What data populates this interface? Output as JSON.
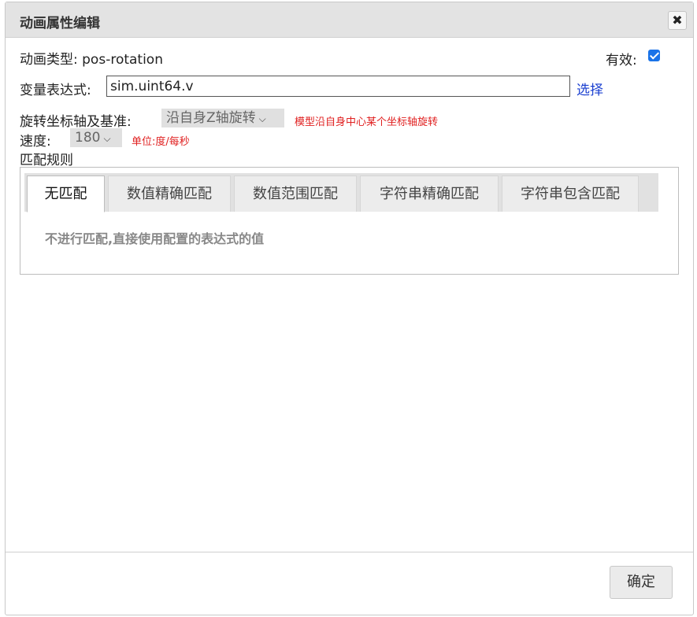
{
  "dialog": {
    "title": "动画属性编辑",
    "close_icon": "✖"
  },
  "anim_type": {
    "label": "动画类型:",
    "value": "pos-rotation"
  },
  "valid": {
    "label": "有效:",
    "checked": true
  },
  "expression": {
    "label": "变量表达式:",
    "value": "sim.uint64.v",
    "choose_link": "选择"
  },
  "rotation_axis": {
    "label": "旋转坐标轴及基准:",
    "selected": "沿自身Z轴旋转",
    "note": "模型沿自身中心某个坐标轴旋转"
  },
  "speed": {
    "label": "速度:",
    "selected": "180",
    "note": "单位:度/每秒"
  },
  "match_rules": {
    "label": "匹配规则",
    "tabs": [
      {
        "label": "无匹配",
        "active": true
      },
      {
        "label": "数值精确匹配",
        "active": false
      },
      {
        "label": "数值范围匹配",
        "active": false
      },
      {
        "label": "字符串精确匹配",
        "active": false
      },
      {
        "label": "字符串包含匹配",
        "active": false
      }
    ],
    "description": "不进行匹配,直接使用配置的表达式的值"
  },
  "footer": {
    "ok_label": "确定"
  },
  "colors": {
    "link": "#1a3fd0",
    "note": "#e02020",
    "checkbox": "#1a73e8"
  },
  "icons": {
    "close": "close-icon",
    "checkbox": "checkmark-icon",
    "dropdown": "chevron-down-icon"
  }
}
